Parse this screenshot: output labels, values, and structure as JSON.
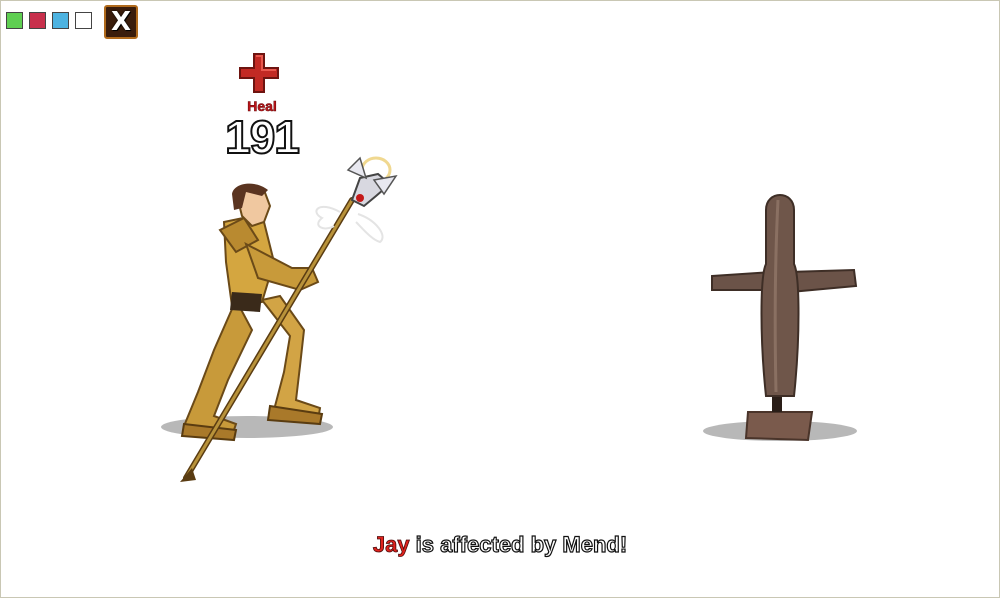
{
  "toolbar": {
    "swatches": [
      {
        "name": "green",
        "color": "#5fcf52"
      },
      {
        "name": "red",
        "color": "#c8304c"
      },
      {
        "name": "blue",
        "color": "#4db3e1"
      },
      {
        "name": "white",
        "color": "#ffffff"
      }
    ],
    "close_label": "X"
  },
  "combat": {
    "heal_icon": "red-cross-icon",
    "heal_label": "Heal",
    "heal_value": "191"
  },
  "message": {
    "name": "Jay",
    "text": " is affected by Mend!"
  }
}
